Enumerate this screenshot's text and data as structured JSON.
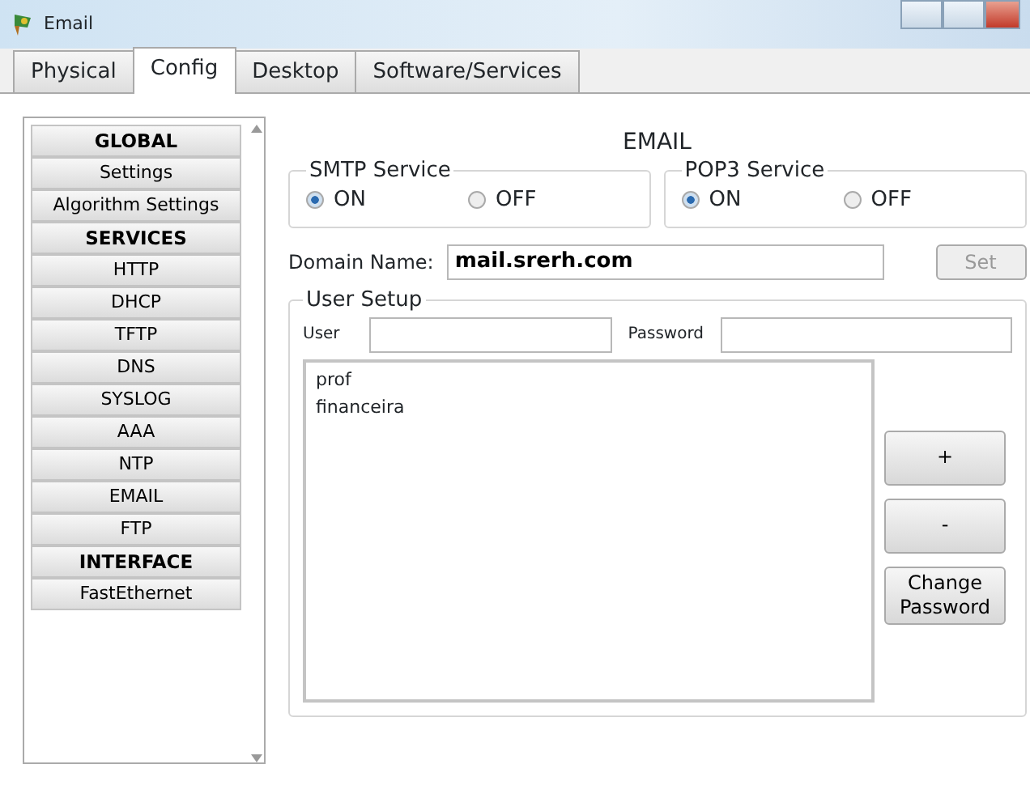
{
  "window": {
    "title": "Email"
  },
  "tabs": [
    {
      "label": "Physical",
      "selected": false
    },
    {
      "label": "Config",
      "selected": true
    },
    {
      "label": "Desktop",
      "selected": false
    },
    {
      "label": "Software/Services",
      "selected": false
    }
  ],
  "sidebar": {
    "items": [
      {
        "label": "GLOBAL",
        "kind": "header"
      },
      {
        "label": "Settings",
        "kind": "item"
      },
      {
        "label": "Algorithm Settings",
        "kind": "item"
      },
      {
        "label": "SERVICES",
        "kind": "header"
      },
      {
        "label": "HTTP",
        "kind": "item"
      },
      {
        "label": "DHCP",
        "kind": "item"
      },
      {
        "label": "TFTP",
        "kind": "item"
      },
      {
        "label": "DNS",
        "kind": "item"
      },
      {
        "label": "SYSLOG",
        "kind": "item"
      },
      {
        "label": "AAA",
        "kind": "item"
      },
      {
        "label": "NTP",
        "kind": "item"
      },
      {
        "label": "EMAIL",
        "kind": "item"
      },
      {
        "label": "FTP",
        "kind": "item"
      },
      {
        "label": "INTERFACE",
        "kind": "header"
      },
      {
        "label": "FastEthernet",
        "kind": "item"
      }
    ]
  },
  "panel": {
    "title": "EMAIL",
    "services": [
      {
        "legend": "SMTP Service",
        "options": [
          {
            "label": "ON",
            "selected": true
          },
          {
            "label": "OFF",
            "selected": false
          }
        ]
      },
      {
        "legend": "POP3 Service",
        "options": [
          {
            "label": "ON",
            "selected": true
          },
          {
            "label": "OFF",
            "selected": false
          }
        ]
      }
    ],
    "domain": {
      "label": "Domain Name:",
      "value": "mail.srerh.com",
      "button": "Set",
      "button_disabled": true
    },
    "user_setup": {
      "legend": "User Setup",
      "user_label": "User",
      "password_label": "Password",
      "users": [
        "prof",
        "financeira"
      ],
      "buttons": [
        "+",
        "-",
        "Change Password"
      ]
    }
  }
}
